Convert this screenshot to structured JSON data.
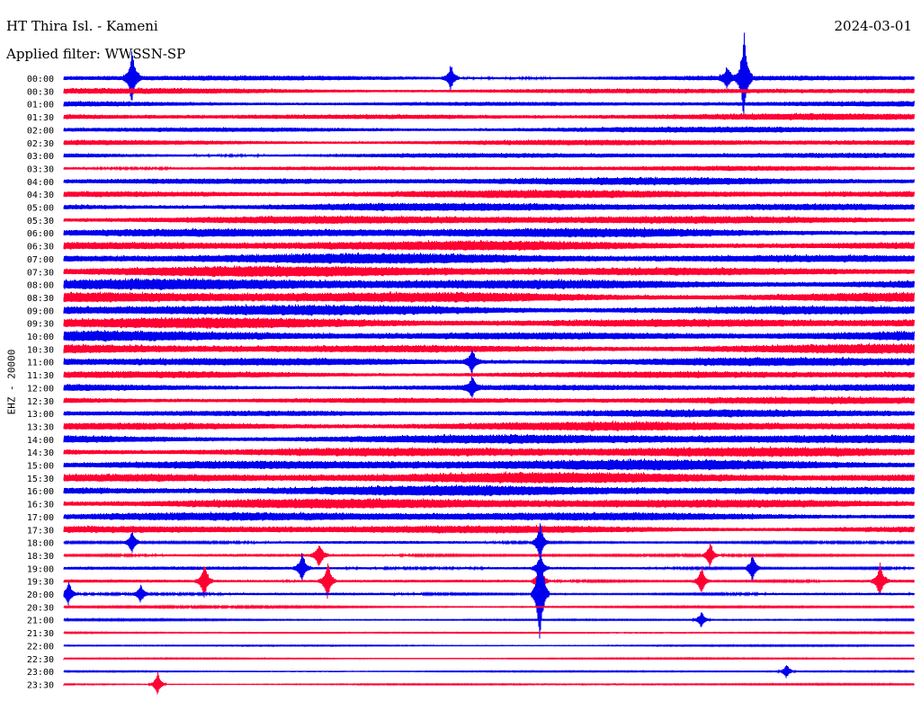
{
  "header": {
    "station": "HT Thira Isl. - Kameni",
    "date": "2024-03-01",
    "filter": "Applied filter: WWSSN-SP"
  },
  "chart_data": {
    "type": "line",
    "subtype": "helicorder",
    "ylabel": "EHZ - 20000",
    "row_labels": [
      "00:00",
      "00:30",
      "01:00",
      "01:30",
      "02:00",
      "02:30",
      "03:00",
      "03:30",
      "04:00",
      "04:30",
      "05:00",
      "05:30",
      "06:00",
      "06:30",
      "07:00",
      "07:30",
      "08:00",
      "08:30",
      "09:00",
      "09:30",
      "10:00",
      "10:30",
      "11:00",
      "11:30",
      "12:00",
      "12:30",
      "13:00",
      "13:30",
      "14:00",
      "14:30",
      "15:00",
      "15:30",
      "16:00",
      "16:30",
      "17:00",
      "17:30",
      "18:00",
      "18:30",
      "19:00",
      "19:30",
      "20:00",
      "20:30",
      "21:00",
      "21:30",
      "22:00",
      "22:30",
      "23:00",
      "23:30"
    ],
    "series_colors": [
      "#0000ee",
      "#ff0033"
    ],
    "noise_amplitude": [
      0.5,
      0.55,
      0.5,
      0.6,
      0.55,
      0.55,
      0.5,
      0.45,
      0.7,
      0.75,
      0.75,
      0.8,
      0.9,
      0.9,
      0.95,
      1.0,
      1.05,
      1.05,
      1.0,
      1.0,
      0.95,
      0.9,
      0.85,
      0.7,
      0.65,
      0.65,
      0.7,
      0.85,
      0.9,
      0.95,
      1.0,
      1.0,
      0.95,
      0.95,
      0.85,
      0.75,
      0.25,
      0.25,
      0.3,
      0.3,
      0.25,
      0.18,
      0.15,
      0.12,
      0.12,
      0.12,
      0.12,
      0.12
    ],
    "events": [
      {
        "row": 0,
        "t": 0.08,
        "amp": 5.5
      },
      {
        "row": 0,
        "t": 0.455,
        "amp": 2.5
      },
      {
        "row": 0,
        "t": 0.78,
        "amp": 2.2
      },
      {
        "row": 0,
        "t": 0.8,
        "amp": 9
      },
      {
        "row": 22,
        "t": 0.48,
        "amp": 2.5
      },
      {
        "row": 24,
        "t": 0.48,
        "amp": 2
      },
      {
        "row": 36,
        "t": 0.56,
        "amp": 4
      },
      {
        "row": 36,
        "t": 0.08,
        "amp": 2.5
      },
      {
        "row": 37,
        "t": 0.3,
        "amp": 2.5
      },
      {
        "row": 37,
        "t": 0.76,
        "amp": 2.5
      },
      {
        "row": 38,
        "t": 0.28,
        "amp": 3
      },
      {
        "row": 38,
        "t": 0.81,
        "amp": 3
      },
      {
        "row": 38,
        "t": 0.56,
        "amp": 2.8
      },
      {
        "row": 39,
        "t": 0.165,
        "amp": 3.5
      },
      {
        "row": 39,
        "t": 0.31,
        "amp": 4
      },
      {
        "row": 39,
        "t": 0.56,
        "amp": 3.5
      },
      {
        "row": 39,
        "t": 0.75,
        "amp": 3
      },
      {
        "row": 39,
        "t": 0.96,
        "amp": 3.5
      },
      {
        "row": 40,
        "t": 0.56,
        "amp": 12
      },
      {
        "row": 40,
        "t": 0.005,
        "amp": 2.5
      },
      {
        "row": 40,
        "t": 0.09,
        "amp": 2
      },
      {
        "row": 42,
        "t": 0.75,
        "amp": 1.8
      },
      {
        "row": 46,
        "t": 0.85,
        "amp": 1.5
      },
      {
        "row": 47,
        "t": 0.11,
        "amp": 2.5
      }
    ]
  }
}
